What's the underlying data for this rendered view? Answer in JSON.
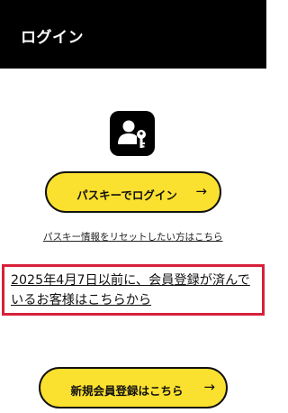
{
  "header": {
    "title": "ログイン"
  },
  "logo": {
    "icon": "passkey-icon"
  },
  "passkey_button": {
    "label": "パスキーでログイン",
    "arrow": "→",
    "color": "#fbe12f"
  },
  "reset_link": {
    "text": "パスキー情報をリセットしたい方はこちら"
  },
  "notice": {
    "text": "2025年4月7日以前に、会員登録が済んでいるお客様はこちらから",
    "border_color": "#d8203a"
  },
  "register_button": {
    "label": "新規会員登録はこちら",
    "arrow": "→",
    "color": "#fbe12f"
  }
}
